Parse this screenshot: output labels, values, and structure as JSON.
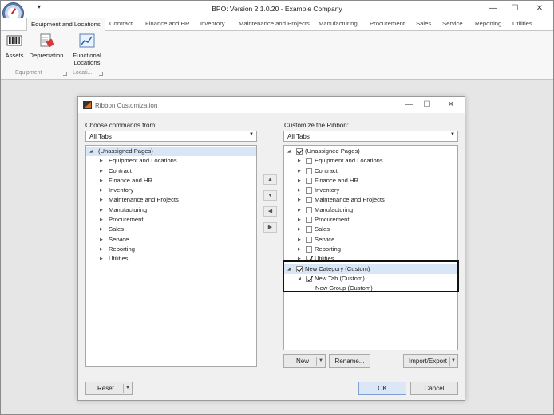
{
  "app": {
    "title": "BPO: Version 2.1.0.20 - Example Company",
    "qat_arrow": "▾",
    "window_controls": {
      "minimize": "—",
      "maximize": "☐",
      "close": "✕"
    }
  },
  "ribbon": {
    "tabs": [
      {
        "label": "Equipment and Locations",
        "active": true
      },
      {
        "label": "Contract"
      },
      {
        "label": "Finance and HR"
      },
      {
        "label": "Inventory"
      },
      {
        "label": "Maintenance and Projects"
      },
      {
        "label": "Manufacturing"
      },
      {
        "label": "Procurement"
      },
      {
        "label": "Sales"
      },
      {
        "label": "Service"
      },
      {
        "label": "Reporting"
      },
      {
        "label": "Utilities"
      }
    ],
    "buttons": {
      "assets": {
        "label": "Assets",
        "icon": "barcode-icon"
      },
      "depreciation": {
        "label": "Depreciation",
        "icon": "depreciation-icon"
      },
      "functional_locations": {
        "label1": "Functional",
        "label2": "Locations",
        "icon": "chart-icon"
      }
    },
    "groups": {
      "equipment": "Equipment",
      "locations": "Locati..."
    }
  },
  "dialog": {
    "title": "Ribbon Customization",
    "window_controls": {
      "minimize": "—",
      "maximize": "☐",
      "close": "✕"
    },
    "left": {
      "label": "Choose commands from:",
      "combo_value": "All Tabs",
      "root": "(Unassigned Pages)",
      "items": [
        "Equipment and Locations",
        "Contract",
        "Finance and HR",
        "Inventory",
        "Maintenance and Projects",
        "Manufacturing",
        "Procurement",
        "Sales",
        "Service",
        "Reporting",
        "Utilities"
      ]
    },
    "right": {
      "label": "Customize the Ribbon:",
      "combo_value": "All Tabs",
      "root": "(Unassigned Pages)",
      "items": [
        {
          "label": "Equipment and Locations",
          "checked": false
        },
        {
          "label": "Contract",
          "checked": false
        },
        {
          "label": "Finance and HR",
          "checked": false
        },
        {
          "label": "Inventory",
          "checked": false
        },
        {
          "label": "Maintenance and Projects",
          "checked": false
        },
        {
          "label": "Manufacturing",
          "checked": false
        },
        {
          "label": "Procurement",
          "checked": false
        },
        {
          "label": "Sales",
          "checked": false
        },
        {
          "label": "Service",
          "checked": false
        },
        {
          "label": "Reporting",
          "checked": false
        },
        {
          "label": "Utilities",
          "checked": true
        }
      ],
      "new_category": "New Category (Custom)",
      "new_tab": "New Tab (Custom)",
      "new_group": "New Group (Custom)"
    },
    "arrows": {
      "up": "▲",
      "down": "▼",
      "add": "◀",
      "remove": "▶"
    },
    "buttons": {
      "new": "New",
      "rename": "Rename...",
      "import_export": "Import/Export",
      "reset": "Reset",
      "ok": "OK",
      "cancel": "Cancel"
    },
    "colors": {
      "selection": "#d9e6f7",
      "accent": "#7ea0d6"
    }
  }
}
